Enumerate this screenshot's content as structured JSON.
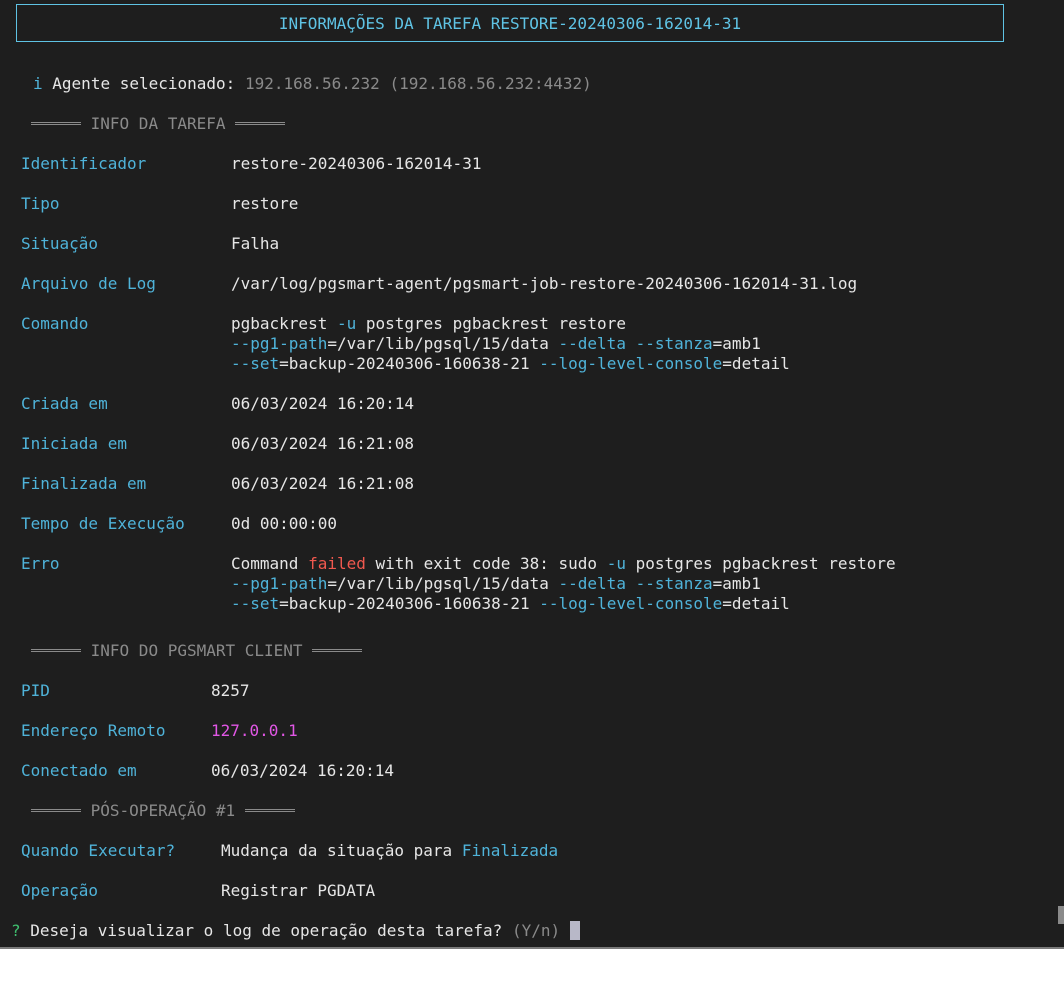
{
  "title": "INFORMAÇÕES DA TAREFA RESTORE-20240306-162014-31",
  "agent": {
    "icon": "info-icon",
    "icon_glyph": "i",
    "label": "Agente selecionado:",
    "value": "192.168.56.232 (192.168.56.232:4432)"
  },
  "task_section": {
    "heading": "INFO DA TAREFA",
    "identificador": {
      "label": "Identificador",
      "value": "restore-20240306-162014-31"
    },
    "tipo": {
      "label": "Tipo",
      "value": "restore"
    },
    "situacao": {
      "label": "Situação",
      "value": "Falha"
    },
    "arquivo_log": {
      "label": "Arquivo de Log",
      "value": "/var/log/pgsmart-agent/pgsmart-job-restore-20240306-162014-31.log"
    },
    "comando": {
      "label": "Comando",
      "line1": {
        "a": "pgbackrest ",
        "flag_u": "-u",
        "b": " postgres pgbackrest restore"
      },
      "line2": {
        "flag_pg1": "--pg1-path",
        "pg1": "=/var/lib/pgsql/15/data ",
        "flag_delta": "--delta",
        "sp": " ",
        "flag_stanza": "--stanza",
        "stanza": "=amb1"
      },
      "line3": {
        "flag_set": "--set",
        "set": "=backup-20240306-160638-21 ",
        "flag_log": "--log-level-console",
        "log": "=detail"
      }
    },
    "criada_em": {
      "label": "Criada em",
      "value": "06/03/2024 16:20:14"
    },
    "iniciada_em": {
      "label": "Iniciada em",
      "value": "06/03/2024 16:21:08"
    },
    "finalizada_em": {
      "label": "Finalizada em",
      "value": "06/03/2024 16:21:08"
    },
    "tempo_execucao": {
      "label": "Tempo de Execução",
      "value": "0d 00:00:00"
    },
    "erro": {
      "label": "Erro",
      "line1": {
        "a": "Command ",
        "failed": "failed",
        "b": " with exit code 38: sudo ",
        "flag_u": "-u",
        "c": " postgres pgbackrest restore"
      },
      "line2": {
        "flag_pg1": "--pg1-path",
        "pg1": "=/var/lib/pgsql/15/data ",
        "flag_delta": "--delta",
        "sp": " ",
        "flag_stanza": "--stanza",
        "stanza": "=amb1"
      },
      "line3": {
        "flag_set": "--set",
        "set": "=backup-20240306-160638-21 ",
        "flag_log": "--log-level-console",
        "log": "=detail"
      }
    }
  },
  "client_section": {
    "heading": "INFO DO PGSMART CLIENT",
    "pid": {
      "label": "PID",
      "value": "8257"
    },
    "endereco": {
      "label": "Endereço Remoto",
      "value": "127.0.0.1"
    },
    "conectado": {
      "label": "Conectado em",
      "value": "06/03/2024 16:20:14"
    }
  },
  "post_section": {
    "heading": "PÓS-OPERAÇÃO #1",
    "quando": {
      "label": "Quando Executar?",
      "value_prefix": "Mudança da situação para ",
      "value_highlight": "Finalizada"
    },
    "operacao": {
      "label": "Operação",
      "value": "Registrar PGDATA"
    }
  },
  "prompt": {
    "marker": "?",
    "question": "Deseja visualizar o log de operação desta tarefa?",
    "hint": "(Y/n)"
  },
  "colors": {
    "background": "#1e1e1e",
    "accent_cyan": "#4fb3d9",
    "error_red": "#f0584e",
    "address_magenta": "#e257e6",
    "prompt_green": "#3fbf6f",
    "muted_grey": "#8a8a8a"
  }
}
